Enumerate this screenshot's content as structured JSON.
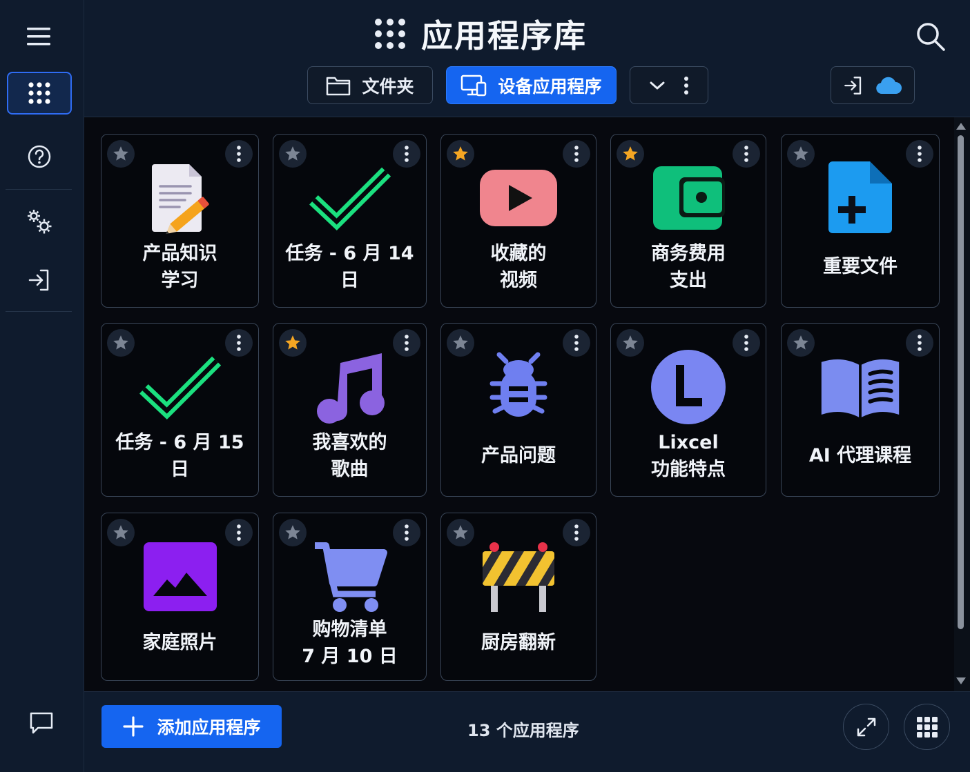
{
  "header": {
    "title": "应用程序库",
    "tabs": [
      {
        "label": "文件夹",
        "icon": "folder-icon",
        "active": false
      },
      {
        "label": "设备应用程序",
        "icon": "device-icon",
        "active": true
      }
    ]
  },
  "sidebar": {
    "items": [
      "menu-icon",
      "apps-grid-icon",
      "help-icon",
      "settings-icon",
      "sign-in-icon"
    ]
  },
  "apps": [
    {
      "label": "产品知识\n学习",
      "starred": false,
      "icon": "document-edit-icon"
    },
    {
      "label": "任务 - 6 月 14 日",
      "starred": false,
      "icon": "checkmark-icon"
    },
    {
      "label": "收藏的\n视频",
      "starred": true,
      "icon": "video-play-icon"
    },
    {
      "label": "商务费用\n支出",
      "starred": true,
      "icon": "wallet-icon"
    },
    {
      "label": "重要文件",
      "starred": false,
      "icon": "file-add-icon"
    },
    {
      "label": "任务 - 6 月 15 日",
      "starred": false,
      "icon": "checkmark-icon"
    },
    {
      "label": "我喜欢的\n歌曲",
      "starred": true,
      "icon": "music-note-icon"
    },
    {
      "label": "产品问题",
      "starred": false,
      "icon": "bug-icon"
    },
    {
      "label": "Lixcel\n功能特点",
      "starred": false,
      "icon": "letter-l-icon"
    },
    {
      "label": "AI 代理课程",
      "starred": false,
      "icon": "open-book-icon"
    },
    {
      "label": "家庭照片",
      "starred": false,
      "icon": "photo-icon"
    },
    {
      "label": "购物清单\n7 月 10 日",
      "starred": false,
      "icon": "cart-icon"
    },
    {
      "label": "厨房翻新",
      "starred": false,
      "icon": "barrier-icon"
    }
  ],
  "footer": {
    "add_label": "添加应用程序",
    "count_text": "13 个应用程序"
  },
  "colors": {
    "accent": "#1565f0",
    "star_active": "#f5a623",
    "star_inactive": "#7c8594"
  }
}
